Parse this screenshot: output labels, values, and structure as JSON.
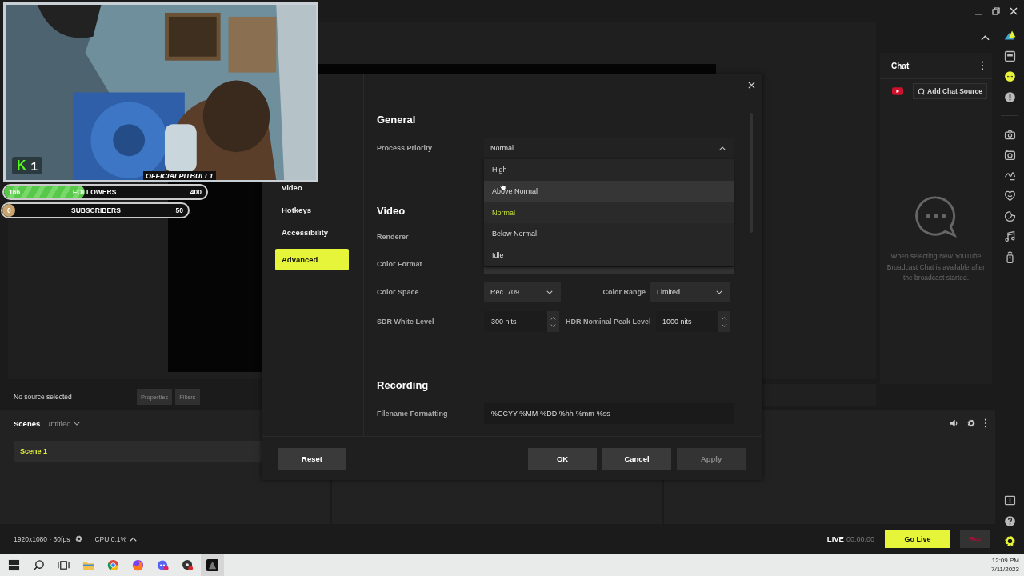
{
  "webcam_overlay": {
    "kind": "picture",
    "badge_letter": "K",
    "badge_count": "1",
    "channel_name": "OFFICIALPITBULL1",
    "followers": {
      "current": "166",
      "label": "FOLLOWERS",
      "goal": "400",
      "level": 0.4
    },
    "subscribers": {
      "current": "0",
      "label": "SUBSCRIBERS",
      "goal": "50",
      "level": 0
    }
  },
  "source_bar": {
    "status": "No source selected",
    "buttons": [
      {
        "label": "Properties",
        "disabled": true
      },
      {
        "label": "Filters",
        "disabled": true
      }
    ]
  },
  "scenes": {
    "title": "Scenes",
    "collection": "Untitled",
    "items": [
      {
        "label": "Scene 1",
        "selected": true
      }
    ]
  },
  "chat": {
    "title": "Chat",
    "add_source": "Add Chat Source",
    "empty_message": "When selecting New YouTube Broadcast Chat is available after the broadcast started."
  },
  "rail_top": [
    {
      "kind": "themes",
      "selected": false
    },
    {
      "kind": "layout",
      "selected": false
    },
    {
      "kind": "chat",
      "selected": true
    },
    {
      "kind": "alert",
      "selected": false
    }
  ],
  "rail_tools": [
    {
      "kind": "camera"
    },
    {
      "kind": "replay"
    },
    {
      "kind": "highlighter"
    },
    {
      "kind": "heart"
    },
    {
      "kind": "sticker"
    },
    {
      "kind": "music"
    },
    {
      "kind": "remote"
    }
  ],
  "rail_bottom": [
    {
      "kind": "report",
      "selected": false
    },
    {
      "kind": "help",
      "selected": false
    },
    {
      "kind": "settings",
      "selected": true
    }
  ],
  "status_bar": {
    "resolution": "1920x1080 · 30fps",
    "cpu": "CPU 0.1%",
    "live_label": "LIVE",
    "timer": "00:00:00",
    "go_live": "Go Live",
    "rec": "Rec"
  },
  "settings_dialog": {
    "nav": [
      {
        "label": "Video",
        "selected": false
      },
      {
        "label": "Hotkeys",
        "selected": false
      },
      {
        "label": "Accessibility",
        "selected": false
      },
      {
        "label": "Advanced",
        "selected": true
      }
    ],
    "general": {
      "title": "General",
      "process_priority": {
        "label": "Process Priority",
        "value": "Normal",
        "expanded": true,
        "options": [
          {
            "label": "High",
            "selected": false,
            "hovered": false
          },
          {
            "label": "Above Normal",
            "selected": false,
            "hovered": true
          },
          {
            "label": "Normal",
            "selected": true,
            "hovered": false
          },
          {
            "label": "Below Normal",
            "selected": false,
            "hovered": false
          },
          {
            "label": "Idle",
            "selected": false,
            "hovered": false
          }
        ]
      }
    },
    "video": {
      "title": "Video",
      "renderer": {
        "label": "Renderer"
      },
      "color_format": {
        "label": "Color Format"
      },
      "color_space": {
        "label": "Color Space",
        "value": "Rec. 709"
      },
      "color_range": {
        "label": "Color Range",
        "value": "Limited"
      },
      "sdr_white_level": {
        "label": "SDR White Level",
        "value": "300 nits"
      },
      "hdr_nominal_peak_level": {
        "label": "HDR Nominal Peak Level",
        "value": "1000 nits"
      }
    },
    "recording": {
      "title": "Recording",
      "filename_formatting": {
        "label": "Filename Formatting",
        "value": "%CCYY-%MM-%DD %hh-%mm-%ss"
      }
    },
    "reset_button": {
      "label": "Reset"
    },
    "buttons": [
      {
        "label": "OK",
        "disabled": false
      },
      {
        "label": "Cancel",
        "disabled": false
      },
      {
        "label": "Apply",
        "disabled": true
      }
    ]
  },
  "taskbar": {
    "time": "12:09 PM",
    "date": "7/11/2023"
  }
}
